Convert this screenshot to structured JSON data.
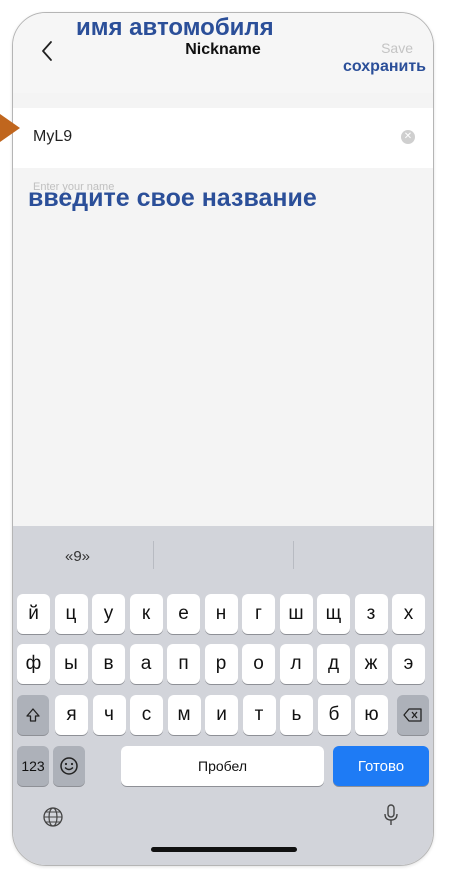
{
  "nav": {
    "title": "Nickname",
    "save_label": "Save"
  },
  "field": {
    "value": "MyL9",
    "hint": "Enter your name"
  },
  "keyboard": {
    "suggestion": "«9»",
    "row1": [
      "й",
      "ц",
      "у",
      "к",
      "е",
      "н",
      "г",
      "ш",
      "щ",
      "з",
      "х"
    ],
    "row2": [
      "ф",
      "ы",
      "в",
      "а",
      "п",
      "р",
      "о",
      "л",
      "д",
      "ж",
      "э"
    ],
    "row3": [
      "я",
      "ч",
      "с",
      "м",
      "и",
      "т",
      "ь",
      "б",
      "ю"
    ],
    "numbers_label": "123",
    "space_label": "Пробел",
    "done_label": "Готово"
  },
  "annotations": {
    "car_name": "имя автомобиля",
    "save": "сохранить",
    "enter_name": "введите свое название"
  },
  "colors": {
    "accent_blue": "#1e7bf5",
    "annotation_blue": "#2b4f99",
    "arrow_orange": "#c0661e"
  }
}
